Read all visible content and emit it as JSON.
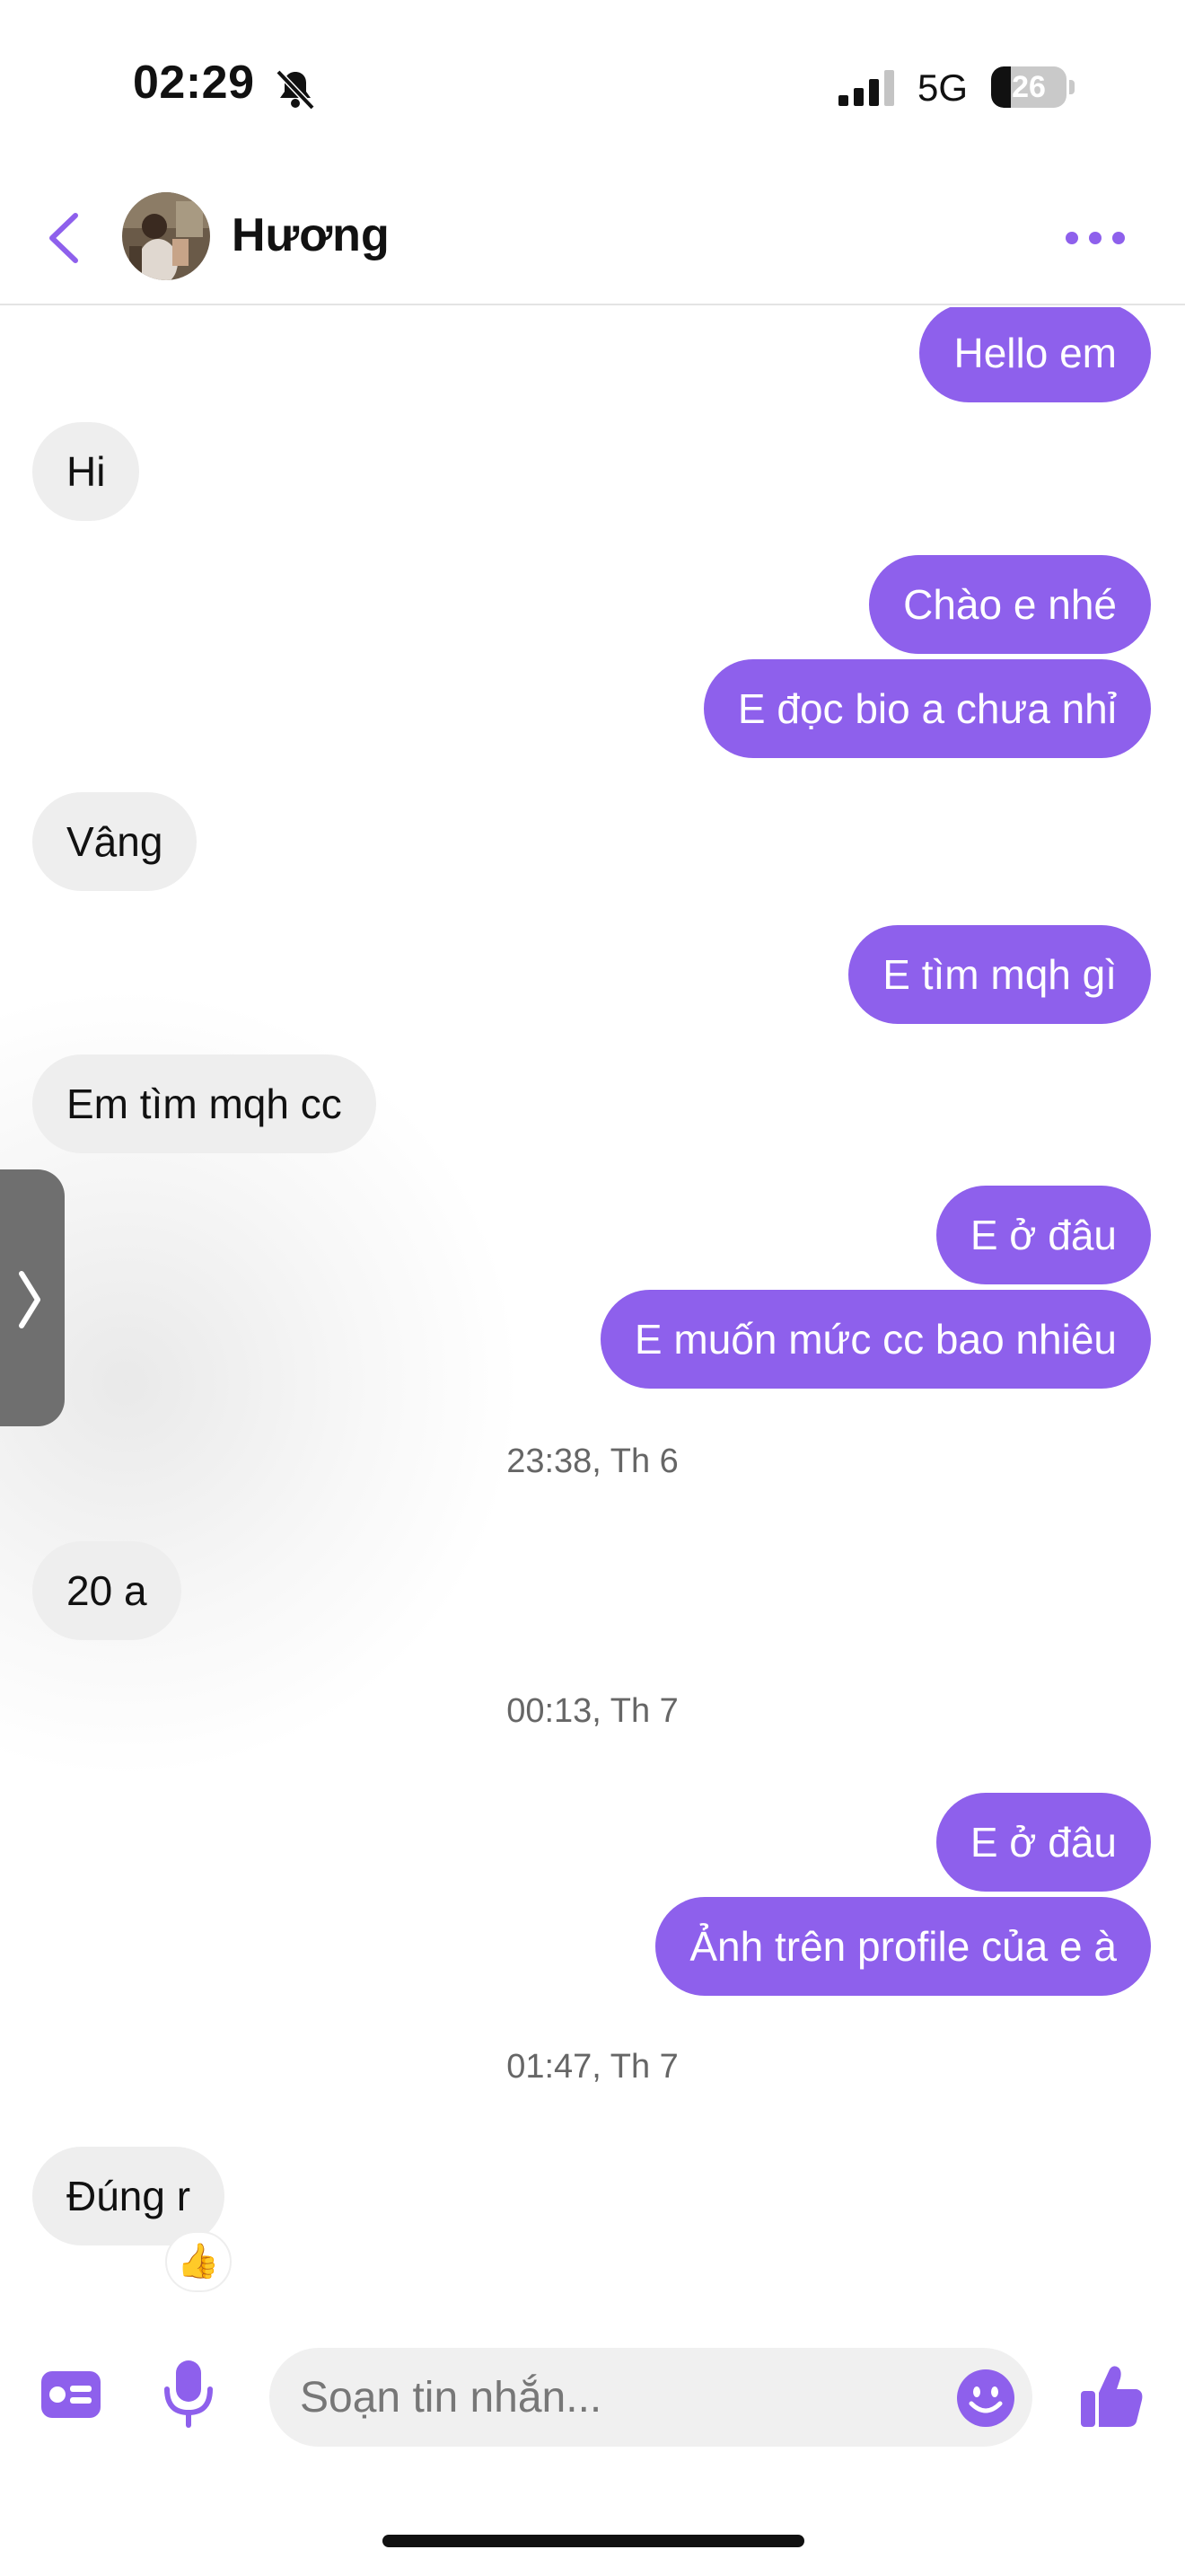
{
  "status_bar": {
    "time": "02:29",
    "network": "5G",
    "battery": "26",
    "battery_level": 0.26,
    "icons": [
      "bell-slash-icon",
      "signal-bars-icon",
      "battery-icon"
    ]
  },
  "header": {
    "contact_name": "Hương",
    "back_icon": "chevron-left-icon",
    "more_icon": "more-horizontal-icon"
  },
  "messages": [
    {
      "side": "out",
      "text": "Hello em"
    },
    {
      "side": "in",
      "text": "Hi"
    },
    {
      "side": "out",
      "text": "Chào e nhé"
    },
    {
      "side": "out",
      "text": "E đọc bio a chưa nhỉ"
    },
    {
      "side": "in",
      "text": "Vâng"
    },
    {
      "side": "out",
      "text": "E tìm mqh gì"
    },
    {
      "side": "in",
      "text": "Em tìm mqh cc"
    },
    {
      "side": "out",
      "text": "E ở đâu"
    },
    {
      "side": "out",
      "text": "E muốn mức cc bao nhiêu"
    },
    {
      "side": "in",
      "text": "20 a"
    },
    {
      "side": "out",
      "text": "E ở đâu"
    },
    {
      "side": "out",
      "text": "Ảnh trên profile của e à"
    },
    {
      "side": "in",
      "text": "Đúng r",
      "reaction": "👍"
    }
  ],
  "timestamps": [
    "23:38, Th 6",
    "00:13, Th 7",
    "01:47, Th 7"
  ],
  "composer": {
    "placeholder": "Soạn tin nhắn...",
    "icons": [
      "id-card-icon",
      "microphone-icon",
      "emoji-icon",
      "thumbs-up-icon"
    ]
  },
  "colors": {
    "accent": "#8e60ec",
    "incoming_bubble": "#eeeeee",
    "timestamp_text": "#666666"
  }
}
